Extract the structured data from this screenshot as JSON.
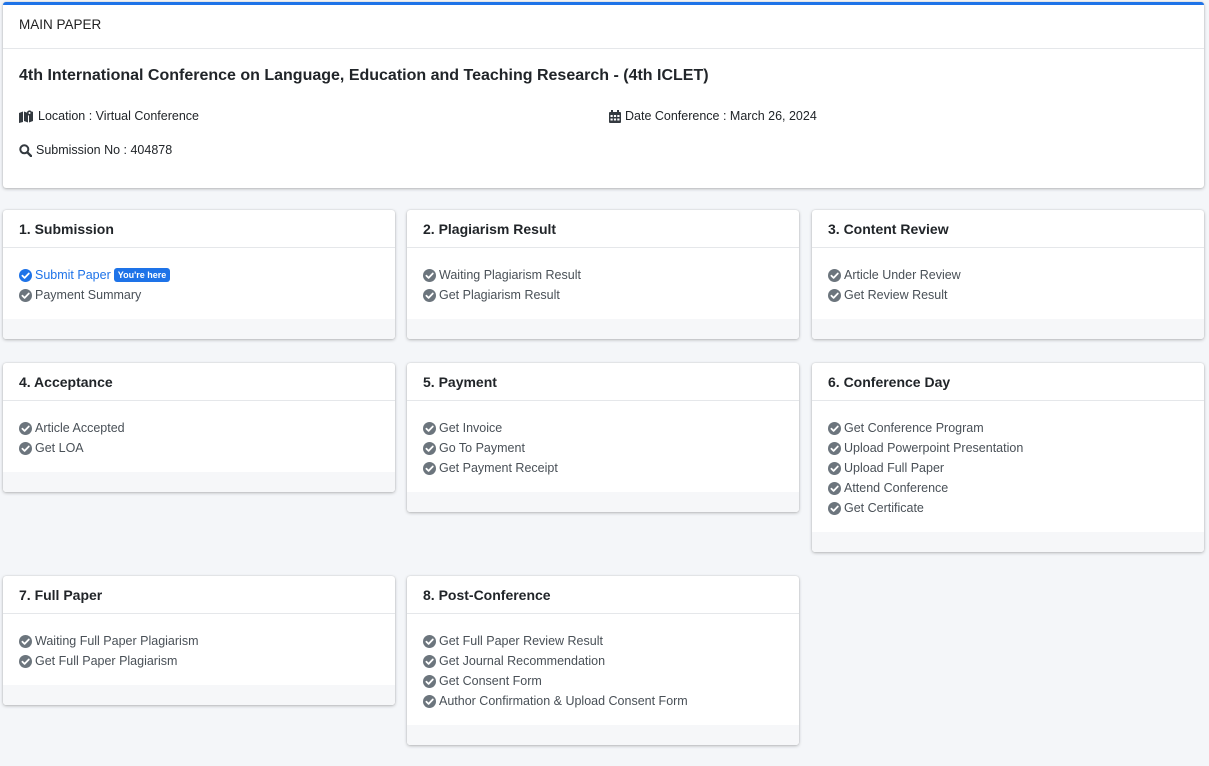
{
  "main": {
    "header": "MAIN PAPER",
    "title": "4th International Conference on Language, Education and Teaching Research - (4th ICLET)",
    "location": "Location : Virtual Conference",
    "date": "Date Conference : March 26, 2024",
    "submission": "Submission No : 404878"
  },
  "steps": [
    {
      "title": "1. Submission",
      "items": [
        "Submit Paper",
        "Payment Summary"
      ],
      "badge": "You're here"
    },
    {
      "title": "2. Plagiarism Result",
      "items": [
        "Waiting Plagiarism Result",
        "Get Plagiarism Result"
      ]
    },
    {
      "title": "3. Content Review",
      "items": [
        "Article Under Review",
        "Get Review Result"
      ]
    },
    {
      "title": "4. Acceptance",
      "items": [
        "Article Accepted",
        "Get LOA"
      ]
    },
    {
      "title": "5. Payment",
      "items": [
        "Get Invoice",
        "Go To Payment",
        "Get Payment Receipt"
      ]
    },
    {
      "title": "6. Conference Day",
      "items": [
        "Get Conference Program",
        "Upload Powerpoint Presentation",
        "Upload Full Paper",
        "Attend Conference",
        "Get Certificate"
      ]
    },
    {
      "title": "7. Full Paper",
      "items": [
        "Waiting Full Paper Plagiarism",
        "Get Full Paper Plagiarism"
      ]
    },
    {
      "title": "8. Post-Conference",
      "items": [
        "Get Full Paper Review Result",
        "Get Journal Recommendation",
        "Get Consent Form",
        "Author Confirmation & Upload Consent Form"
      ]
    }
  ],
  "colors": {
    "accent": "#1e73e8",
    "check": "#6c757d",
    "background": "#f4f6f9"
  }
}
